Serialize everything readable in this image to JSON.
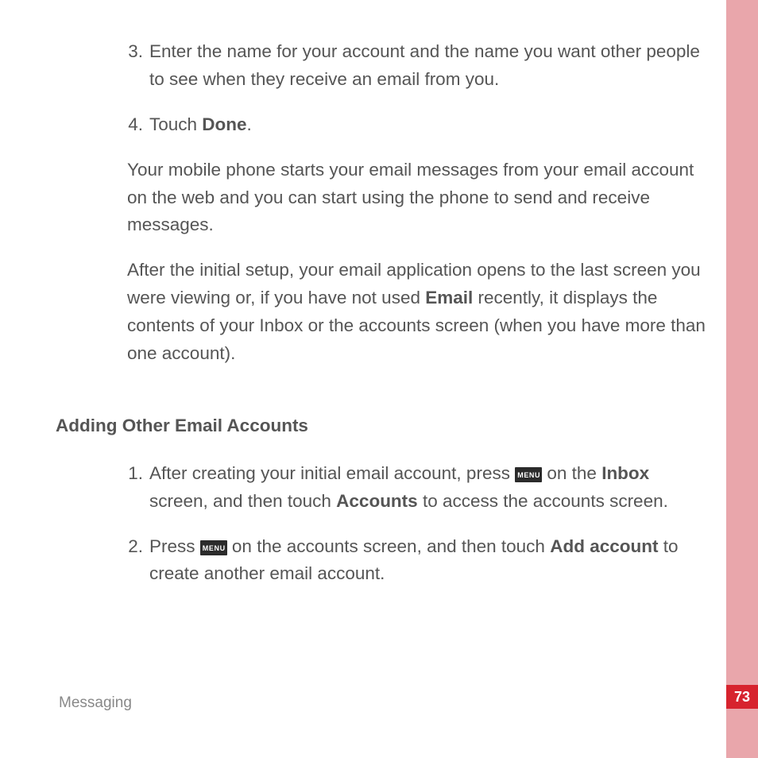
{
  "footer": {
    "section": "Messaging",
    "page_number": "73"
  },
  "steps_continued": [
    {
      "marker": "3.",
      "text": "Enter the name for your account and the name you want other people to see when they receive an email from you."
    },
    {
      "marker": "4.",
      "prefix": "Touch ",
      "bold": "Done",
      "suffix": "."
    }
  ],
  "paragraphs": {
    "p1": "Your mobile phone starts your email messages from your email account on the web and you can start using the phone to send and receive messages.",
    "p2_a": "After the initial setup, your email application opens to the last screen you were viewing or, if you have not used ",
    "p2_bold": "Email",
    "p2_b": " recently, it displays the contents of your Inbox or the accounts screen (when you have more than one account)."
  },
  "section_heading": "Adding Other Email Accounts",
  "adding_steps": {
    "s1": {
      "marker": "1.",
      "a": "After creating your initial email account, press ",
      "menu": "MENU",
      "b": " on the ",
      "bold1": "Inbox",
      "c": " screen, and then touch ",
      "bold2": "Accounts",
      "d": " to access the accounts screen."
    },
    "s2": {
      "marker": "2.",
      "a": "Press ",
      "menu": "MENU",
      "b": " on the accounts screen, and then touch ",
      "bold1": "Add account",
      "c": " to create another email account."
    }
  }
}
